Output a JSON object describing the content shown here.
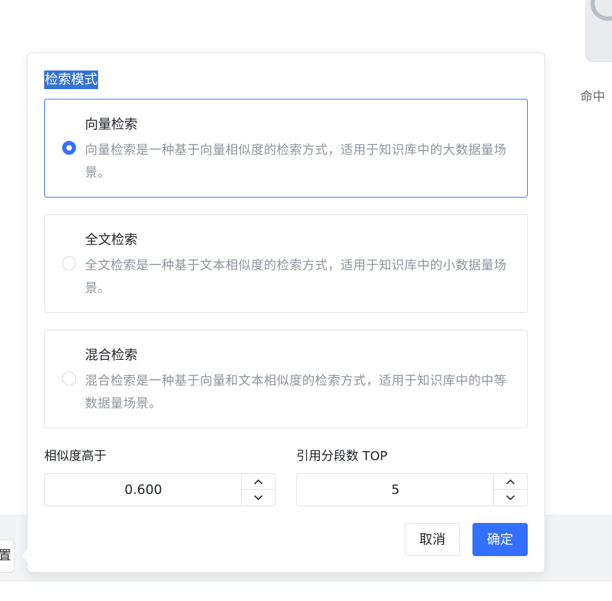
{
  "background": {
    "side_label": "命中",
    "left_button_label": "置"
  },
  "popover": {
    "title": "检索模式",
    "modes": [
      {
        "title": "向量检索",
        "description": "向量检索是一种基于向量相似度的检索方式，适用于知识库中的大数据量场景。",
        "selected": true
      },
      {
        "title": "全文检索",
        "description": "全文检索是一种基于文本相似度的检索方式，适用于知识库中的小数据量场景。",
        "selected": false
      },
      {
        "title": "混合检索",
        "description": "混合检索是一种基于向量和文本相似度的检索方式，适用于知识库中的中等数据量场景。",
        "selected": false
      }
    ],
    "similarity": {
      "label": "相似度高于",
      "value": "0.600"
    },
    "top_n": {
      "label": "引用分段数 TOP",
      "value": "5"
    },
    "cancel_label": "取消",
    "confirm_label": "确定"
  },
  "colors": {
    "primary": "#3370ff",
    "title_highlight": "#3572d4",
    "description_text": "#8f959e"
  }
}
